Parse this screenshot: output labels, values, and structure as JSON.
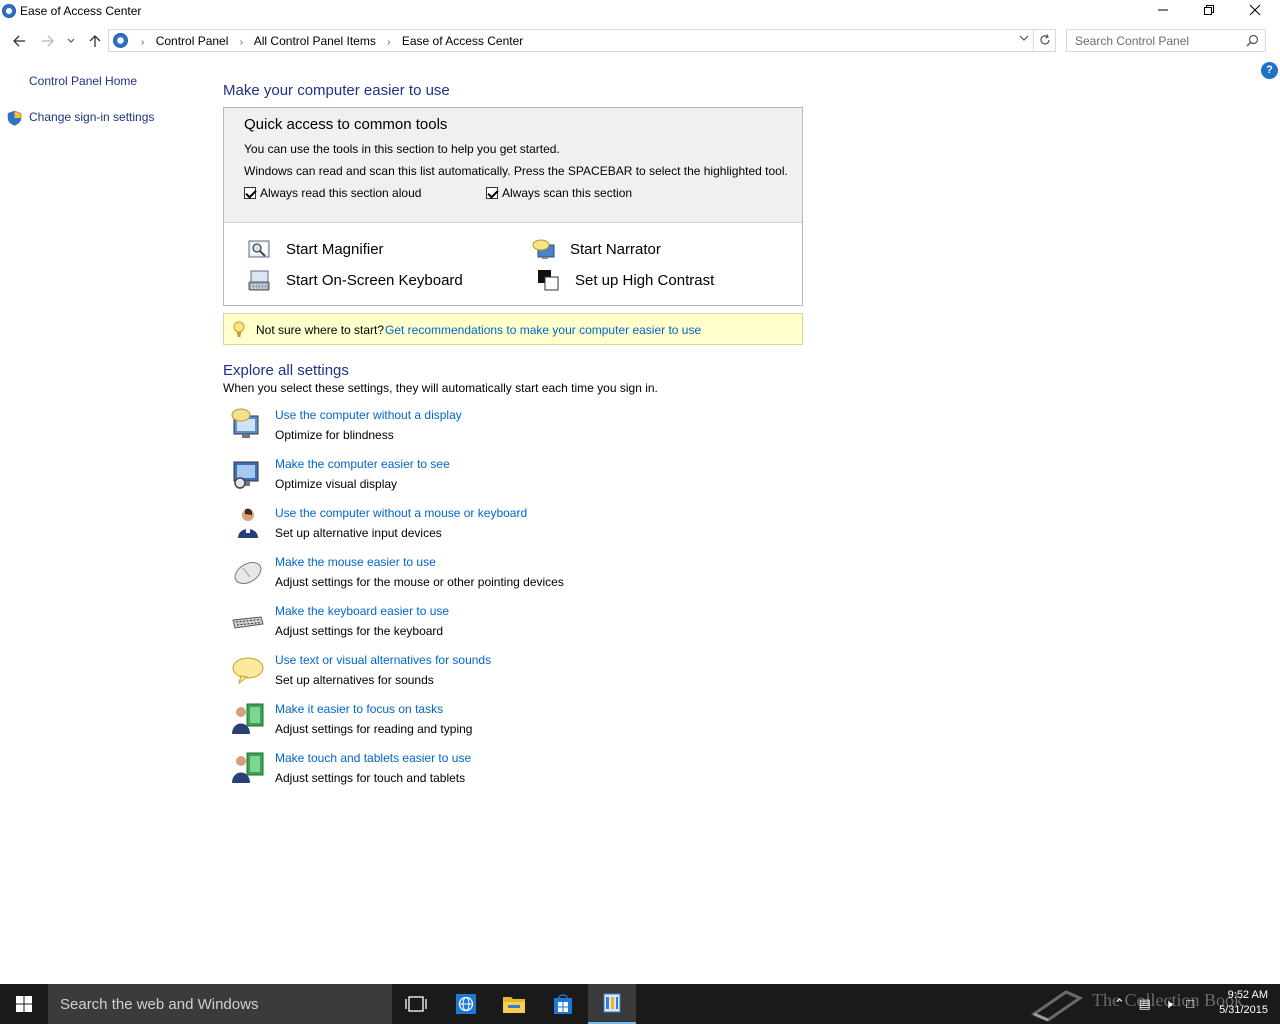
{
  "window": {
    "title": "Ease of Access Center"
  },
  "nav": {
    "breadcrumbs": [
      "Control Panel",
      "All Control Panel Items",
      "Ease of Access Center"
    ],
    "search_placeholder": "Search Control Panel"
  },
  "sidebar": {
    "home": "Control Panel Home",
    "signin": "Change sign-in settings"
  },
  "main": {
    "heading": "Make your computer easier to use",
    "quick": {
      "title": "Quick access to common tools",
      "line1": "You can use the tools in this section to help you get started.",
      "line2": "Windows can read and scan this list automatically.  Press the SPACEBAR to select the highlighted tool.",
      "check1": "Always read this section aloud",
      "check2": "Always scan this section",
      "tools": [
        "Start Magnifier",
        "Start Narrator",
        "Start On-Screen Keyboard",
        "Set up High Contrast"
      ]
    },
    "tip": {
      "prefix": "Not sure where to start?",
      "link": "Get recommendations to make your computer easier to use"
    },
    "explore": {
      "heading": "Explore all settings",
      "subtitle": "When you select these settings, they will automatically start each time you sign in.",
      "items": [
        {
          "link": "Use the computer without a display",
          "desc": "Optimize for blindness",
          "icon": "monitor-speech-icon"
        },
        {
          "link": "Make the computer easier to see",
          "desc": "Optimize visual display",
          "icon": "monitor-magnify-icon"
        },
        {
          "link": "Use the computer without a mouse or keyboard",
          "desc": "Set up alternative input devices",
          "icon": "person-icon"
        },
        {
          "link": "Make the mouse easier to use",
          "desc": "Adjust settings for the mouse or other pointing devices",
          "icon": "mouse-icon"
        },
        {
          "link": "Make the keyboard easier to use",
          "desc": "Adjust settings for the keyboard",
          "icon": "keyboard-icon"
        },
        {
          "link": "Use text or visual alternatives for sounds",
          "desc": "Set up alternatives for sounds",
          "icon": "speech-bubble-icon"
        },
        {
          "link": "Make it easier to focus on tasks",
          "desc": "Adjust settings for reading and typing",
          "icon": "people-focus-icon"
        },
        {
          "link": "Make touch and tablets easier to use",
          "desc": "Adjust settings for touch and tablets",
          "icon": "people-touch-icon"
        }
      ]
    }
  },
  "taskbar": {
    "search_text": "Search the web and Windows",
    "time": "9:52 AM",
    "date": "5/31/2015",
    "watermark": "The Collection Book"
  }
}
